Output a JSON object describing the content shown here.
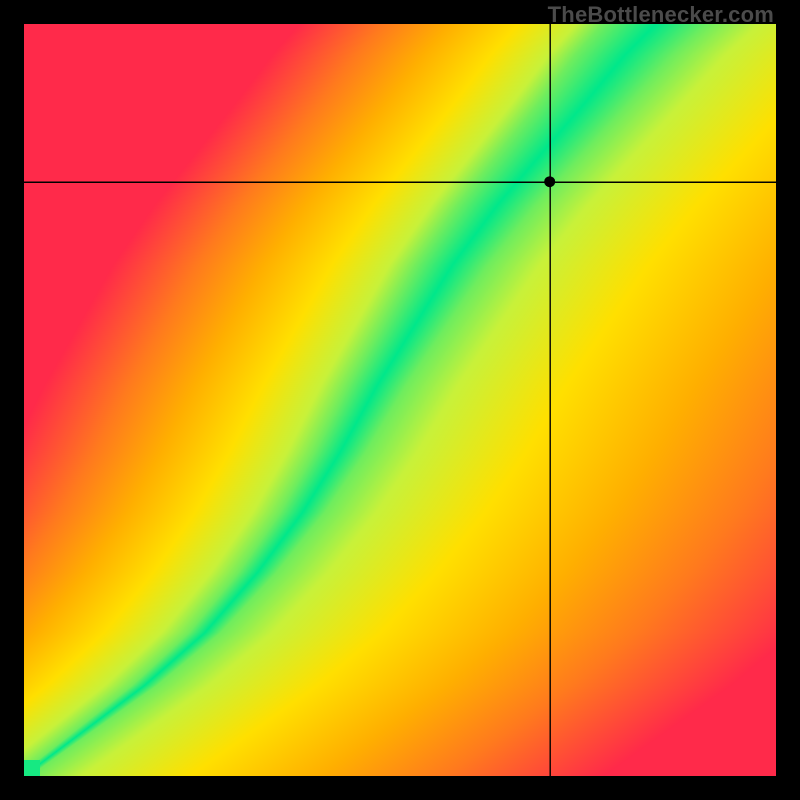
{
  "watermark": "TheBottlenecker.com",
  "chart_data": {
    "type": "heatmap",
    "title": "",
    "xlabel": "",
    "ylabel": "",
    "xlim": [
      0,
      1
    ],
    "ylim": [
      0,
      1
    ],
    "grid": false,
    "marker": {
      "x": 0.7,
      "y": 0.79,
      "style": "dot",
      "crosshair": true
    },
    "curve": {
      "description": "Optimal-balance ridge (green minimum band) running from bottom-left to upper region, bending right as y increases",
      "points": [
        {
          "x": 0.0,
          "y": 0.0
        },
        {
          "x": 0.08,
          "y": 0.06
        },
        {
          "x": 0.16,
          "y": 0.12
        },
        {
          "x": 0.24,
          "y": 0.19
        },
        {
          "x": 0.31,
          "y": 0.27
        },
        {
          "x": 0.37,
          "y": 0.35
        },
        {
          "x": 0.42,
          "y": 0.43
        },
        {
          "x": 0.47,
          "y": 0.52
        },
        {
          "x": 0.52,
          "y": 0.6
        },
        {
          "x": 0.57,
          "y": 0.68
        },
        {
          "x": 0.63,
          "y": 0.76
        },
        {
          "x": 0.69,
          "y": 0.83
        },
        {
          "x": 0.75,
          "y": 0.9
        },
        {
          "x": 0.8,
          "y": 0.96
        },
        {
          "x": 0.84,
          "y": 1.0
        }
      ],
      "band_width_start": 0.008,
      "band_width_end": 0.07
    },
    "colormap": {
      "description": "Distance from ridge: 0 = green, mid = yellow, far = red/orange; asymmetric left/right",
      "stops": [
        {
          "t": 0.0,
          "color": "#00E88B"
        },
        {
          "t": 0.18,
          "color": "#C8F23A"
        },
        {
          "t": 0.35,
          "color": "#FFE000"
        },
        {
          "t": 0.55,
          "color": "#FFB000"
        },
        {
          "t": 0.75,
          "color": "#FF7A1E"
        },
        {
          "t": 1.0,
          "color": "#FF2A4A"
        }
      ]
    }
  }
}
